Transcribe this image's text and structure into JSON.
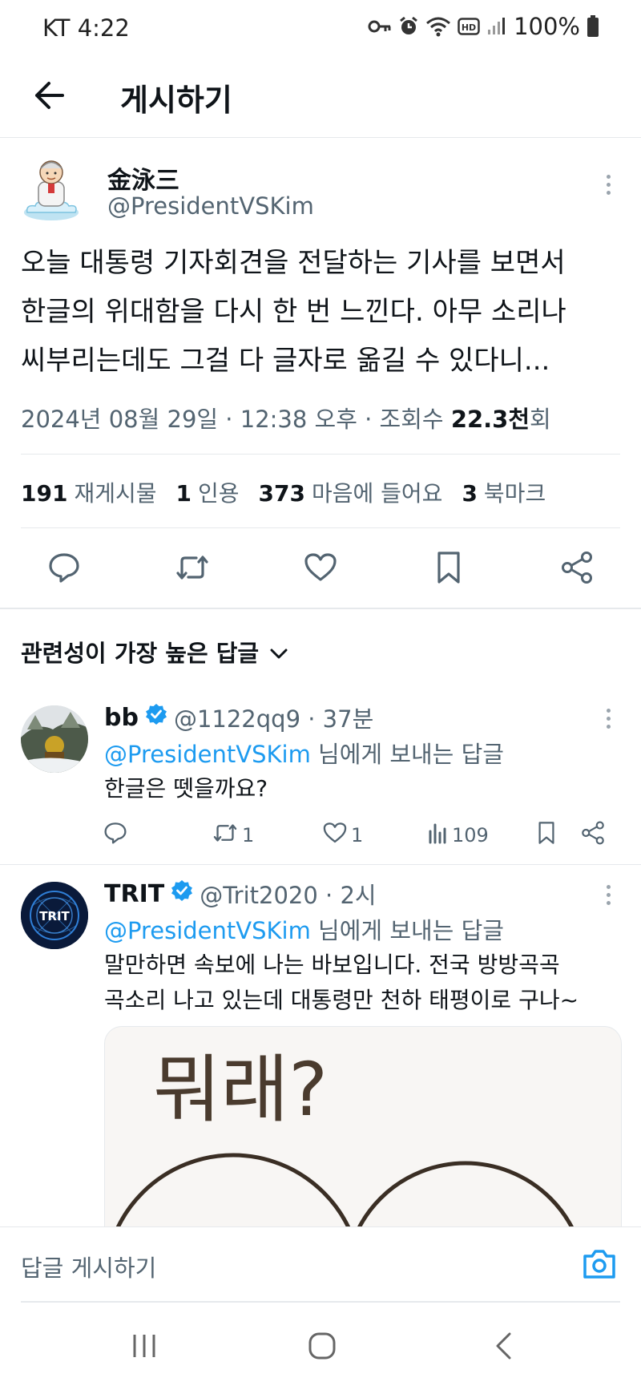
{
  "status_bar": {
    "time": "KT 4:22",
    "battery": "100%",
    "icons": [
      "key-icon",
      "alarm-icon",
      "wifi-icon",
      "hd-icon",
      "signal-icon",
      "battery-icon"
    ]
  },
  "header": {
    "back_icon": "arrow-left-icon",
    "title": "게시하기"
  },
  "tweet": {
    "display_name": "金泳三",
    "handle": "@PresidentVSKim",
    "body_lines": [
      "오늘 대통령 기자회견을 전달하는 기사를 보면서",
      "한글의 위대함을 다시 한 번 느낀다. 아무 소리나",
      "씨부리는데도 그걸 다 글자로 옮길 수 있다니..."
    ],
    "meta_prefix": "2024년 08월 29일 · 12:38 오후 · 조회수 ",
    "views": "22.3천",
    "views_suffix": "회",
    "stats": {
      "retweets": "191",
      "retweets_label": "재게시물",
      "quotes": "1",
      "quotes_label": "인용",
      "likes": "373",
      "likes_label": "마음에 들어요",
      "bookmarks": "3",
      "bookmarks_label": "북마크"
    }
  },
  "sort": {
    "label": "관련성이 가장 높은 답글"
  },
  "replies": [
    {
      "name": "bb",
      "handle": "@1122qq9 · 37분",
      "reply_to_mention": "@PresidentVSKim",
      "reply_to_suffix": " 님에게 보내는 답글",
      "text_lines": [
        "한글은 뗏을까요?"
      ],
      "retweets": "1",
      "likes": "1",
      "views": "109"
    },
    {
      "name": "TRIT",
      "handle": "@Trit2020 · 2시",
      "reply_to_mention": "@PresidentVSKim",
      "reply_to_suffix": " 님에게 보내는 답글",
      "text_lines": [
        "말만하면 속보에 나는 바보입니다. 전국 방방곡곡",
        "곡소리 나고 있는데 대통령만 천하 태평이로 구나~"
      ],
      "avatar_text": "TRIT",
      "image_text": "뭐래?"
    }
  ],
  "compose": {
    "placeholder": "답글 게시하기"
  },
  "colors": {
    "accent": "#1d9bf0",
    "secondary_text": "#536471",
    "primary_text": "#0f1419",
    "divider": "#e6e9ec"
  }
}
